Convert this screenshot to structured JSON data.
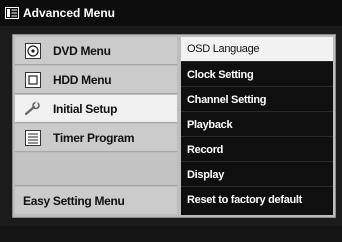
{
  "title": "Advanced Menu",
  "left_menu": [
    {
      "label": "DVD Menu",
      "icon": "disc-icon"
    },
    {
      "label": "HDD Menu",
      "icon": "hdd-icon"
    },
    {
      "label": "Initial Setup",
      "icon": "wrench-icon",
      "selected": true
    },
    {
      "label": "Timer Program",
      "icon": "list-icon"
    },
    {
      "label": ""
    },
    {
      "label": "Easy Setting Menu"
    }
  ],
  "right_menu": [
    {
      "label": "OSD Language",
      "highlighted": true
    },
    {
      "label": "Clock Setting"
    },
    {
      "label": "Channel Setting"
    },
    {
      "label": "Playback"
    },
    {
      "label": "Record"
    },
    {
      "label": "Display"
    },
    {
      "label": "Reset to factory default"
    }
  ]
}
